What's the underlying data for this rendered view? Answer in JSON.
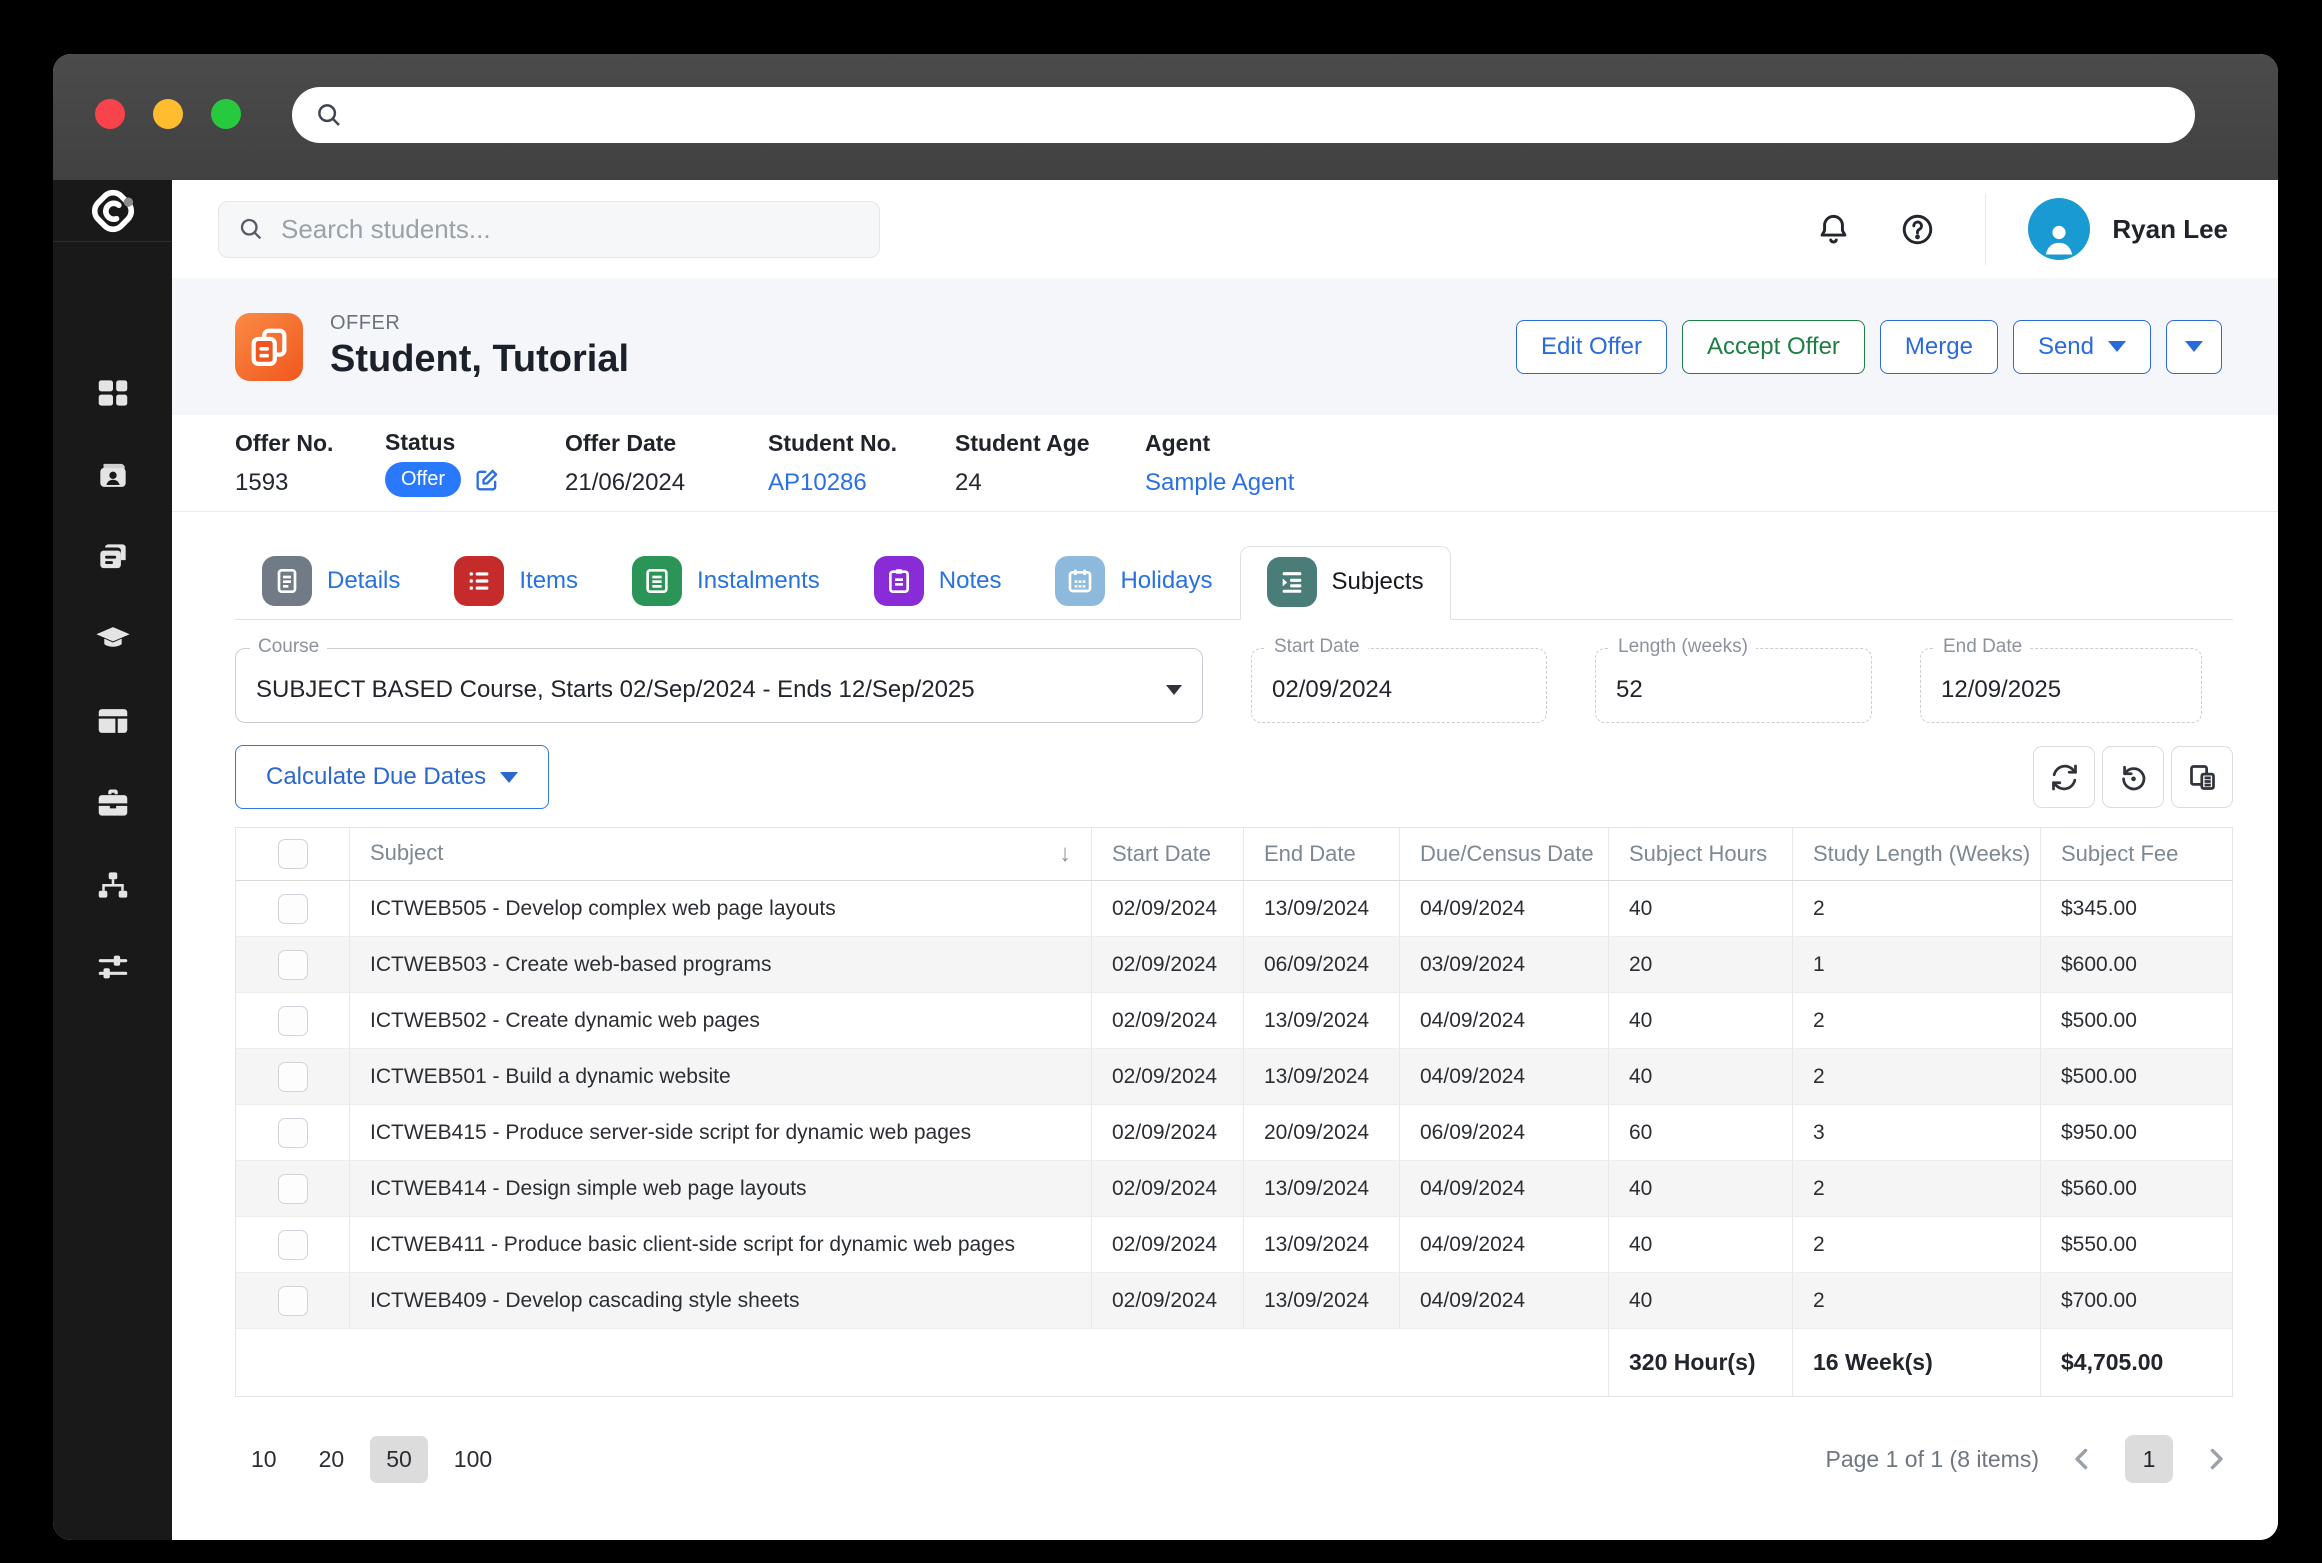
{
  "colors": {
    "accent_blue": "#2b6ade",
    "accent_green": "#1e7e43",
    "badge_blue": "#2979ff",
    "link_blue": "#2b6fe4",
    "offer_icon_orange": "#f0571f",
    "avatar_blue": "#1a9ad2",
    "sidebar_bg": "#191919",
    "tab_details": "#707b87",
    "tab_items": "#c62b2b",
    "tab_instalments": "#2b9457",
    "tab_notes": "#8a2bd8",
    "tab_holidays": "#8cb9dc",
    "tab_subjects": "#4a7d78"
  },
  "header": {
    "search_placeholder": "Search students...",
    "user_name": "Ryan Lee"
  },
  "offer": {
    "kicker": "OFFER",
    "title": "Student, Tutorial",
    "actions": {
      "edit": "Edit Offer",
      "accept": "Accept Offer",
      "merge": "Merge",
      "send": "Send"
    },
    "meta": {
      "offer_no": {
        "label": "Offer No.",
        "value": "1593"
      },
      "status": {
        "label": "Status",
        "value": "Offer"
      },
      "offer_date": {
        "label": "Offer Date",
        "value": "21/06/2024"
      },
      "student_no": {
        "label": "Student No.",
        "value": "AP10286"
      },
      "student_age": {
        "label": "Student Age",
        "value": "24"
      },
      "agent": {
        "label": "Agent",
        "value": "Sample Agent"
      }
    }
  },
  "tabs": [
    {
      "label": "Details",
      "color": "#707b87",
      "active": false
    },
    {
      "label": "Items",
      "color": "#c62b2b",
      "active": false
    },
    {
      "label": "Instalments",
      "color": "#2b9457",
      "active": false
    },
    {
      "label": "Notes",
      "color": "#8a2bd8",
      "active": false
    },
    {
      "label": "Holidays",
      "color": "#8cb9dc",
      "active": false
    },
    {
      "label": "Subjects",
      "color": "#4a7d78",
      "active": true
    }
  ],
  "form": {
    "course": {
      "label": "Course",
      "value": "SUBJECT BASED Course, Starts 02/Sep/2024 - Ends 12/Sep/2025"
    },
    "start_date": {
      "label": "Start Date",
      "value": "02/09/2024"
    },
    "length_weeks": {
      "label": "Length (weeks)",
      "value": "52"
    },
    "end_date": {
      "label": "End Date",
      "value": "12/09/2025"
    }
  },
  "toolbar": {
    "calculate_label": "Calculate Due Dates"
  },
  "table": {
    "columns": [
      "Subject",
      "Start Date",
      "End Date",
      "Due/Census Date",
      "Subject Hours",
      "Study Length (Weeks)",
      "Subject Fee"
    ],
    "rows": [
      {
        "subject": "ICTWEB505 - Develop complex web page layouts",
        "start": "02/09/2024",
        "end": "13/09/2024",
        "due": "04/09/2024",
        "hours": "40",
        "length": "2",
        "fee": "$345.00"
      },
      {
        "subject": "ICTWEB503 - Create web-based programs",
        "start": "02/09/2024",
        "end": "06/09/2024",
        "due": "03/09/2024",
        "hours": "20",
        "length": "1",
        "fee": "$600.00"
      },
      {
        "subject": "ICTWEB502 - Create dynamic web pages",
        "start": "02/09/2024",
        "end": "13/09/2024",
        "due": "04/09/2024",
        "hours": "40",
        "length": "2",
        "fee": "$500.00"
      },
      {
        "subject": "ICTWEB501 - Build a dynamic website",
        "start": "02/09/2024",
        "end": "13/09/2024",
        "due": "04/09/2024",
        "hours": "40",
        "length": "2",
        "fee": "$500.00"
      },
      {
        "subject": "ICTWEB415 - Produce server-side script for dynamic web pages",
        "start": "02/09/2024",
        "end": "20/09/2024",
        "due": "06/09/2024",
        "hours": "60",
        "length": "3",
        "fee": "$950.00"
      },
      {
        "subject": "ICTWEB414 - Design simple web page layouts",
        "start": "02/09/2024",
        "end": "13/09/2024",
        "due": "04/09/2024",
        "hours": "40",
        "length": "2",
        "fee": "$560.00"
      },
      {
        "subject": "ICTWEB411 - Produce basic client-side script for dynamic web pages",
        "start": "02/09/2024",
        "end": "13/09/2024",
        "due": "04/09/2024",
        "hours": "40",
        "length": "2",
        "fee": "$550.00"
      },
      {
        "subject": "ICTWEB409 - Develop cascading style sheets",
        "start": "02/09/2024",
        "end": "13/09/2024",
        "due": "04/09/2024",
        "hours": "40",
        "length": "2",
        "fee": "$700.00"
      }
    ],
    "totals": {
      "hours": "320 Hour(s)",
      "weeks": "16 Week(s)",
      "fee": "$4,705.00"
    }
  },
  "pagination": {
    "sizes": [
      "10",
      "20",
      "50",
      "100"
    ],
    "selected_size": "50",
    "info": "Page 1 of 1 (8 items)",
    "current_page": "1"
  }
}
